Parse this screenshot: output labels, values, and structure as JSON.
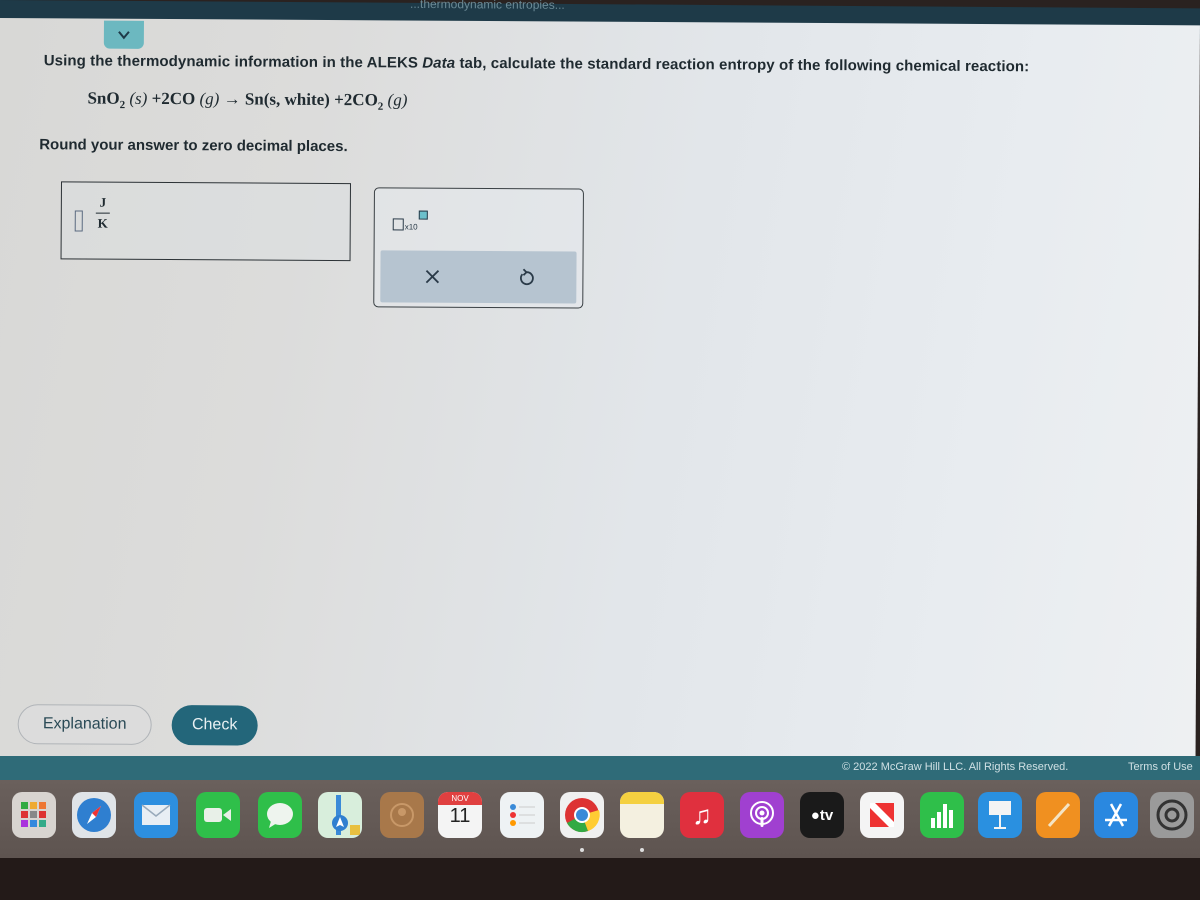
{
  "header": {
    "partial_title": "...thermodynamic entropies..."
  },
  "question": {
    "prefix": "Using the thermodynamic information in the ALEKS ",
    "data_word": "Data",
    "suffix": " tab, calculate the standard reaction entropy of the following chemical reaction:",
    "equation": {
      "reactant1": "SnO",
      "reactant1_sub": "2",
      "reactant1_state": "(s)",
      "plus1": "+",
      "reactant2": "2CO",
      "reactant2_state": "(g)",
      "arrow": "→",
      "product1": "Sn(s, white)",
      "plus2": "+",
      "product2": "2CO",
      "product2_sub": "2",
      "product2_state": "(g)"
    },
    "instruction": "Round your answer to zero decimal places."
  },
  "answer": {
    "value": "",
    "unit_numerator": "J",
    "unit_denominator": "K"
  },
  "keypad": {
    "sci_notation_label": "x10",
    "clear_symbol": "×",
    "undo_symbol": "↺"
  },
  "buttons": {
    "explanation": "Explanation",
    "check": "Check"
  },
  "footer": {
    "copyright": "© 2022 McGraw Hill LLC. All Rights Reserved.",
    "terms": "Terms of Use"
  },
  "dock": {
    "items": [
      {
        "name": "launchpad",
        "label": ""
      },
      {
        "name": "safari",
        "label": ""
      },
      {
        "name": "mail",
        "label": ""
      },
      {
        "name": "facetime",
        "label": ""
      },
      {
        "name": "messages",
        "label": ""
      },
      {
        "name": "maps",
        "label": ""
      },
      {
        "name": "contacts",
        "label": ""
      },
      {
        "name": "calendar",
        "month": "NOV",
        "day": "11"
      },
      {
        "name": "reminders",
        "label": ""
      },
      {
        "name": "chrome",
        "label": ""
      },
      {
        "name": "notes",
        "label": ""
      },
      {
        "name": "music",
        "label": ""
      },
      {
        "name": "podcasts",
        "label": ""
      },
      {
        "name": "apple-tv",
        "label": "tv"
      },
      {
        "name": "news",
        "label": ""
      },
      {
        "name": "numbers",
        "label": ""
      },
      {
        "name": "keynote",
        "label": ""
      },
      {
        "name": "pages",
        "label": ""
      },
      {
        "name": "app-store",
        "label": ""
      },
      {
        "name": "system-preferences",
        "label": ""
      }
    ]
  },
  "colors": {
    "accent": "#23667a",
    "footer": "#2f6b78",
    "collapse_tab": "#6cb8c0"
  }
}
